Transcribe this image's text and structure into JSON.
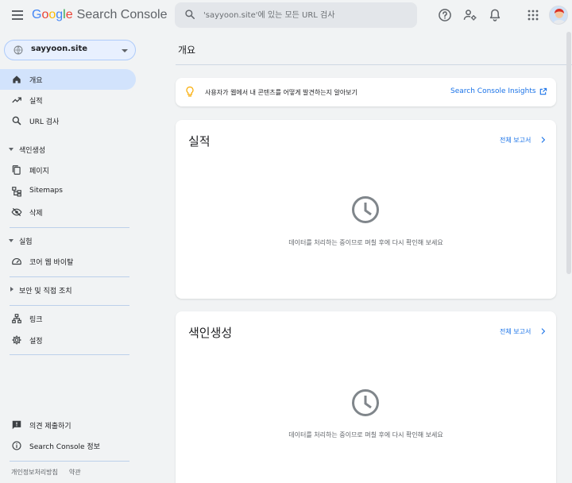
{
  "header": {
    "logo_google": "Google",
    "product_name": "Search Console",
    "search_placeholder": "'sayyoon.site'에 있는 모든 URL 검사",
    "icons": [
      "menu-icon",
      "search-icon",
      "help-icon",
      "manage-users-icon",
      "notifications-icon",
      "apps-icon"
    ]
  },
  "sidebar": {
    "property": "sayyoon.site",
    "nav_top": [
      {
        "label": "개요",
        "icon": "home-icon",
        "active": true
      },
      {
        "label": "실적",
        "icon": "trending-up-icon"
      },
      {
        "label": "URL 검사",
        "icon": "search-icon"
      }
    ],
    "sections": [
      {
        "label": "색인생성",
        "expanded": true,
        "items": [
          {
            "label": "페이지",
            "icon": "pages-icon"
          },
          {
            "label": "Sitemaps",
            "icon": "sitemap-icon"
          },
          {
            "label": "삭제",
            "icon": "removals-icon"
          }
        ]
      },
      {
        "label": "실험",
        "expanded": true,
        "items": [
          {
            "label": "코어 웹 바이탈",
            "icon": "speedometer-icon"
          }
        ]
      },
      {
        "label": "보안 및 직접 조치",
        "expanded": false,
        "items": []
      }
    ],
    "nav_misc": [
      {
        "label": "링크",
        "icon": "links-icon"
      },
      {
        "label": "설정",
        "icon": "settings-icon"
      }
    ],
    "bottom": [
      {
        "label": "의견 제출하기",
        "icon": "feedback-icon"
      },
      {
        "label": "Search Console 정보",
        "icon": "info-icon"
      }
    ],
    "footer": [
      "개인정보처리방침",
      "약관"
    ]
  },
  "main": {
    "page_title": "개요",
    "insight": {
      "text": "사용자가 웹에서 내 콘텐츠를 어떻게 발견하는지 알아보기",
      "link": "Search Console Insights"
    },
    "cards": [
      {
        "title": "실적",
        "report_link": "전체 보고서",
        "status": "데이터를 처리하는 중이므로 며칠 후에 다시 확인해 보세요"
      },
      {
        "title": "색인생성",
        "report_link": "전체 보고서",
        "status": "데이터를 처리하는 중이므로 며칠 후에 다시 확인해 보세요"
      }
    ]
  },
  "colors": {
    "accent": "#1a73e8",
    "active_nav": "#d2e3fc",
    "background": "#f1f3f4",
    "insight_bulb": "#f9ab00"
  }
}
